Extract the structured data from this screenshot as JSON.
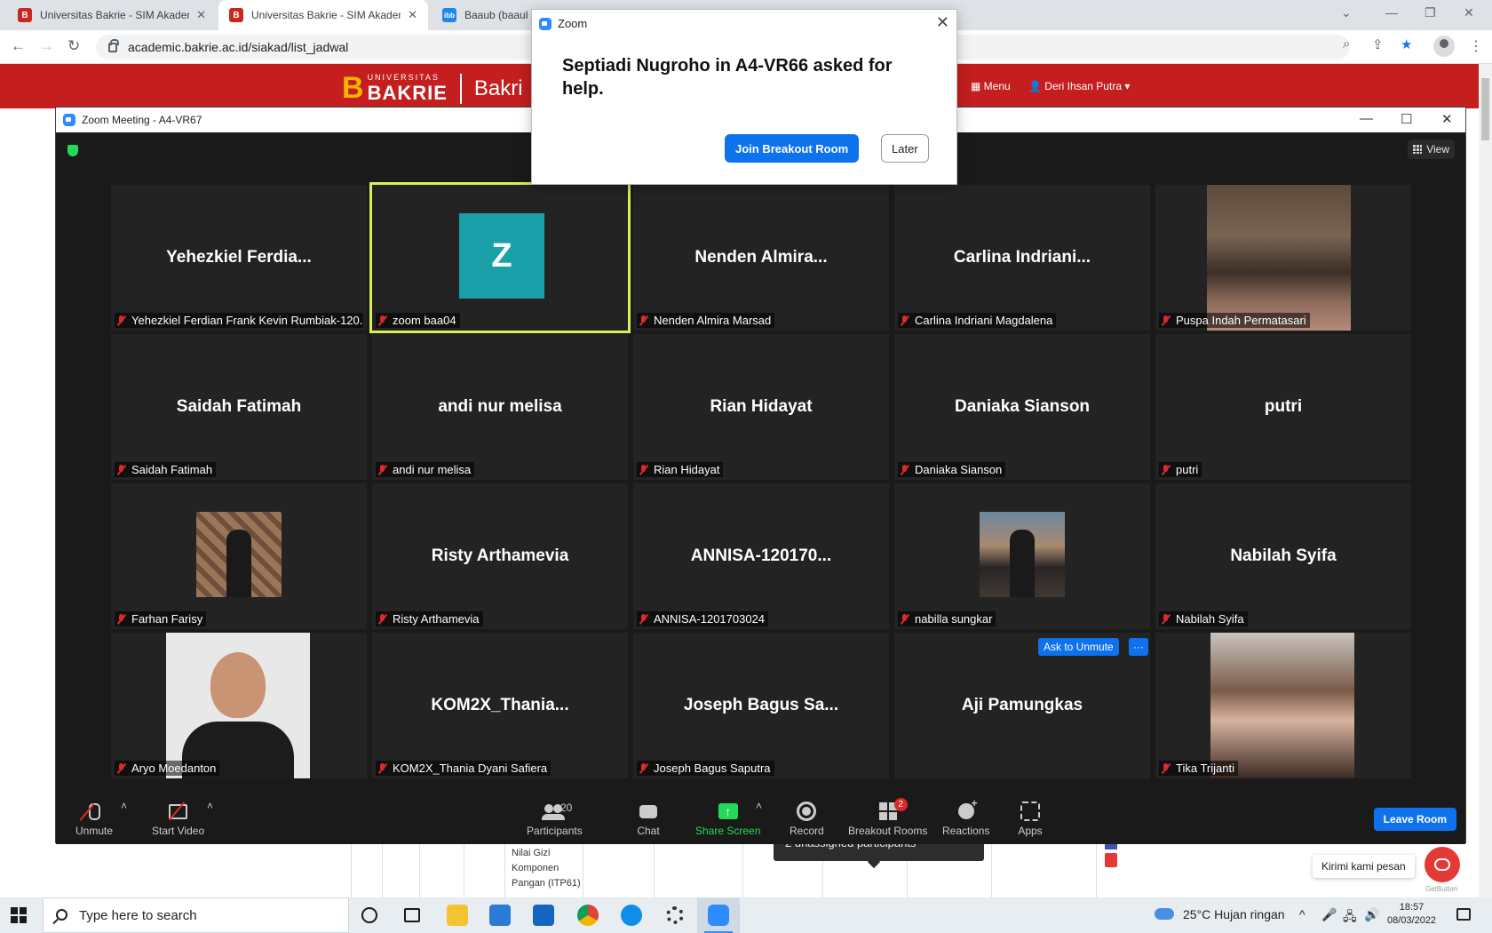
{
  "browser": {
    "tabs": [
      {
        "label": "Universitas Bakrie - SIM Akadem",
        "favicon": "bakrie-favicon",
        "active": false
      },
      {
        "label": "Universitas Bakrie - SIM Akadem",
        "favicon": "bakrie-favicon",
        "active": true
      },
      {
        "label": "Baaub (baaub)",
        "favicon": "ibb-favicon",
        "active": false
      }
    ],
    "url": "academic.bakrie.ac.id/siakad/list_jadwal"
  },
  "site": {
    "logo_small": "UNIVERSITAS",
    "logo_big": "BAKRIE",
    "logo_partial": "Bakri",
    "menu_label": "Menu",
    "user_label": "Deri Ihsan Putra",
    "table_cell": [
      "Nilai Gizi",
      "Komponen",
      "Pangan (ITP61)"
    ],
    "chat_label": "Kirimi kami pesan",
    "getbutton": "GetButton"
  },
  "zoom": {
    "window_title": "Zoom Meeting - A4-VR67",
    "view_label": "View",
    "tiles": [
      {
        "big": "Yehezkiel  Ferdia...",
        "label": "Yehezkiel Ferdian Frank Kevin Rumbiak-120..."
      },
      {
        "big": "",
        "label": "zoom baa04",
        "avatar": "Z",
        "active": true
      },
      {
        "big": "Nenden  Almira...",
        "label": "Nenden Almira Marsad"
      },
      {
        "big": "Carlina  Indriani...",
        "label": "Carlina Indriani Magdalena"
      },
      {
        "big": "",
        "label": "Puspa Indah Permatasari",
        "photo": "p-puspa"
      },
      {
        "big": "Saidah Fatimah",
        "label": "Saidah Fatimah"
      },
      {
        "big": "andi nur melisa",
        "label": "andi nur melisa"
      },
      {
        "big": "Rian Hidayat",
        "label": "Rian Hidayat"
      },
      {
        "big": "Daniaka Sianson",
        "label": "Daniaka Sianson"
      },
      {
        "big": "putri",
        "label": "putri"
      },
      {
        "big": "",
        "label": "Farhan Farisy",
        "photo": "p-farhan"
      },
      {
        "big": "Risty Arthamevia",
        "label": "Risty Arthamevia"
      },
      {
        "big": "ANNISA-120170...",
        "label": "ANNISA-1201703024"
      },
      {
        "big": "",
        "label": "nabilla sungkar",
        "photo": "p-nabilla"
      },
      {
        "big": "Nabilah Syifa",
        "label": "Nabilah Syifa"
      },
      {
        "big": "",
        "label": "Aryo Moedanton",
        "photo": "p-aryo"
      },
      {
        "big": "KOM2X_Thania...",
        "label": "KOM2X_Thania Dyani Safiera"
      },
      {
        "big": "Joseph Bagus Sa...",
        "label": "Joseph Bagus Saputra"
      },
      {
        "big": "Aji Pamungkas",
        "label": "",
        "ask_unmute": true
      },
      {
        "big": "",
        "label": "Tika Trijanti",
        "photo": "p-tika"
      }
    ],
    "ask_unmute_label": "Ask to Unmute",
    "more_label": "···",
    "unassigned_tooltip": "2 unassigned participants",
    "toolbar": {
      "unmute": "Unmute",
      "start_video": "Start Video",
      "participants": "Participants",
      "participants_count": "20",
      "chat": "Chat",
      "share_screen": "Share Screen",
      "record": "Record",
      "breakout_rooms": "Breakout Rooms",
      "breakout_badge": "2",
      "reactions": "Reactions",
      "apps": "Apps",
      "leave_room": "Leave Room"
    },
    "help_popup": {
      "title": "Zoom",
      "message": "Septiadi Nugroho in A4-VR66 asked for help.",
      "join": "Join Breakout Room",
      "later": "Later"
    }
  },
  "taskbar": {
    "search_placeholder": "Type here to search",
    "weather": "25°C  Hujan ringan",
    "time": "18:57",
    "date": "08/03/2022"
  }
}
